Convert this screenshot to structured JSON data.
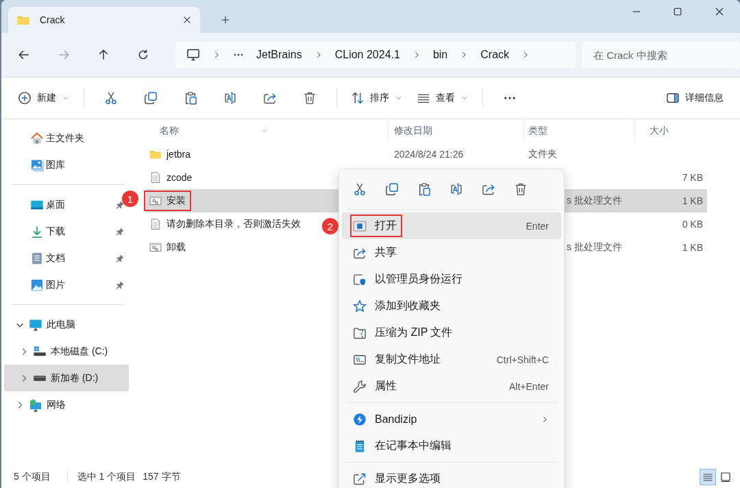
{
  "window": {
    "tab_title": "Crack"
  },
  "address": {
    "crumbs": [
      "JetBrains",
      "CLion 2024.1",
      "bin",
      "Crack"
    ]
  },
  "search": {
    "placeholder": "在 Crack 中搜索"
  },
  "toolbar": {
    "new_label": "新建",
    "sort_label": "排序",
    "view_label": "查看",
    "details_label": "详细信息"
  },
  "sidebar": {
    "quick": [
      {
        "label": "主文件夹",
        "pinned": false
      },
      {
        "label": "图库",
        "pinned": false
      },
      {
        "kind": "separator"
      },
      {
        "label": "桌面",
        "pinned": true
      },
      {
        "label": "下载",
        "pinned": true
      },
      {
        "label": "文档",
        "pinned": true
      },
      {
        "label": "图片",
        "pinned": true
      }
    ],
    "tree": [
      {
        "label": "此电脑",
        "expanded": true,
        "selected": false,
        "children": [
          {
            "label": "本地磁盘 (C:)",
            "expanded": false,
            "selected": false
          },
          {
            "label": "新加卷 (D:)",
            "expanded": false,
            "selected": true
          }
        ]
      },
      {
        "label": "网络",
        "expanded": false,
        "selected": false
      }
    ]
  },
  "table": {
    "columns": [
      "名称",
      "修改日期",
      "类型",
      "大小"
    ],
    "rows": [
      {
        "kind": "folder",
        "name": "jetbra",
        "date": "2024/8/24 21:26",
        "type": "文件夹",
        "selected": false
      },
      {
        "kind": "text",
        "name": "zcode",
        "size": "7 KB",
        "selected": false
      },
      {
        "kind": "batch",
        "name": "安装",
        "type": "s 批处理文件",
        "size": "1 KB",
        "selected": true,
        "marker": "1"
      },
      {
        "kind": "text",
        "name": "请勿删除本目录，否则激活失效",
        "size": "0 KB",
        "selected": false
      },
      {
        "kind": "batch",
        "name": "卸载",
        "type": "s 批处理文件",
        "size": "1 KB",
        "selected": false
      }
    ]
  },
  "context_menu": {
    "items": [
      {
        "kind": "item",
        "label": "打开",
        "shortcut": "Enter",
        "hovered": true,
        "marker": "2"
      },
      {
        "kind": "item",
        "label": "共享",
        "hovered": false
      },
      {
        "kind": "item",
        "label": "以管理员身份运行",
        "hovered": false
      },
      {
        "kind": "item",
        "label": "添加到收藏夹",
        "hovered": false
      },
      {
        "kind": "item",
        "label": "压缩为 ZIP 文件",
        "hovered": false
      },
      {
        "kind": "item",
        "label": "复制文件地址",
        "shortcut": "Ctrl+Shift+C",
        "hovered": false
      },
      {
        "kind": "item",
        "label": "属性",
        "shortcut": "Alt+Enter",
        "hovered": false
      },
      {
        "kind": "separator"
      },
      {
        "kind": "submenu",
        "label": "Bandizip",
        "hovered": false
      },
      {
        "kind": "item",
        "label": "在记事本中编辑",
        "hovered": false
      },
      {
        "kind": "separator"
      },
      {
        "kind": "item",
        "label": "显示更多选项",
        "hovered": false
      }
    ]
  },
  "status_bar": {
    "count": "5 个项目",
    "selection": "选中 1 个项目",
    "size": "157 字节",
    "view_modes": [
      {
        "selected": true
      },
      {
        "selected": false
      }
    ]
  }
}
